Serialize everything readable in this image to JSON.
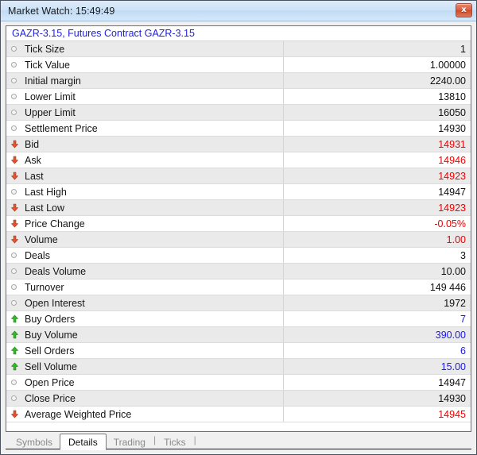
{
  "window": {
    "title": "Market Watch: 15:49:49",
    "close_label": "x"
  },
  "symbol_header": {
    "text": "GAZR-3.15, Futures Contract GAZR-3.15",
    "color": "#2020e0"
  },
  "colors": {
    "value_black": "#101010",
    "value_red": "#f00000",
    "value_blue": "#1818e8",
    "arrow_down": "#e8512a",
    "arrow_up": "#2fbb26",
    "dot": "#a8a8a8"
  },
  "table": {
    "rows": [
      {
        "icon": "neutral-dot-icon",
        "label": "Tick Size",
        "value": "1",
        "value_color": "black"
      },
      {
        "icon": "neutral-dot-icon",
        "label": "Tick Value",
        "value": "1.00000",
        "value_color": "black"
      },
      {
        "icon": "neutral-dot-icon",
        "label": "Initial margin",
        "value": "2240.00",
        "value_color": "black"
      },
      {
        "icon": "neutral-dot-icon",
        "label": "Lower Limit",
        "value": "13810",
        "value_color": "black"
      },
      {
        "icon": "neutral-dot-icon",
        "label": "Upper Limit",
        "value": "16050",
        "value_color": "black"
      },
      {
        "icon": "neutral-dot-icon",
        "label": "Settlement Price",
        "value": "14930",
        "value_color": "black"
      },
      {
        "icon": "arrow-down-icon",
        "label": "Bid",
        "value": "14931",
        "value_color": "red"
      },
      {
        "icon": "arrow-down-icon",
        "label": "Ask",
        "value": "14946",
        "value_color": "red"
      },
      {
        "icon": "arrow-down-icon",
        "label": "Last",
        "value": "14923",
        "value_color": "red"
      },
      {
        "icon": "neutral-dot-icon",
        "label": "Last High",
        "value": "14947",
        "value_color": "black"
      },
      {
        "icon": "arrow-down-icon",
        "label": "Last Low",
        "value": "14923",
        "value_color": "red"
      },
      {
        "icon": "arrow-down-icon",
        "label": "Price Change",
        "value": "-0.05%",
        "value_color": "red"
      },
      {
        "icon": "arrow-down-icon",
        "label": "Volume",
        "value": "1.00",
        "value_color": "red"
      },
      {
        "icon": "neutral-dot-icon",
        "label": "Deals",
        "value": "3",
        "value_color": "black"
      },
      {
        "icon": "neutral-dot-icon",
        "label": "Deals Volume",
        "value": "10.00",
        "value_color": "black"
      },
      {
        "icon": "neutral-dot-icon",
        "label": "Turnover",
        "value": "149 446",
        "value_color": "black"
      },
      {
        "icon": "neutral-dot-icon",
        "label": "Open Interest",
        "value": "1972",
        "value_color": "black"
      },
      {
        "icon": "arrow-up-icon",
        "label": "Buy Orders",
        "value": "7",
        "value_color": "blue"
      },
      {
        "icon": "arrow-up-icon",
        "label": "Buy Volume",
        "value": "390.00",
        "value_color": "blue"
      },
      {
        "icon": "arrow-up-icon",
        "label": "Sell Orders",
        "value": "6",
        "value_color": "blue"
      },
      {
        "icon": "arrow-up-icon",
        "label": "Sell Volume",
        "value": "15.00",
        "value_color": "blue"
      },
      {
        "icon": "neutral-dot-icon",
        "label": "Open Price",
        "value": "14947",
        "value_color": "black"
      },
      {
        "icon": "neutral-dot-icon",
        "label": "Close Price",
        "value": "14930",
        "value_color": "black"
      },
      {
        "icon": "arrow-down-icon",
        "label": "Average Weighted Price",
        "value": "14945",
        "value_color": "red"
      }
    ]
  },
  "tabs": {
    "items": [
      {
        "label": "Symbols",
        "active": false,
        "sep_after": false
      },
      {
        "label": "Details",
        "active": true,
        "sep_after": false
      },
      {
        "label": "Trading",
        "active": false,
        "sep_after": true
      },
      {
        "label": "Ticks",
        "active": false,
        "sep_after": true
      }
    ],
    "separator": "|"
  }
}
